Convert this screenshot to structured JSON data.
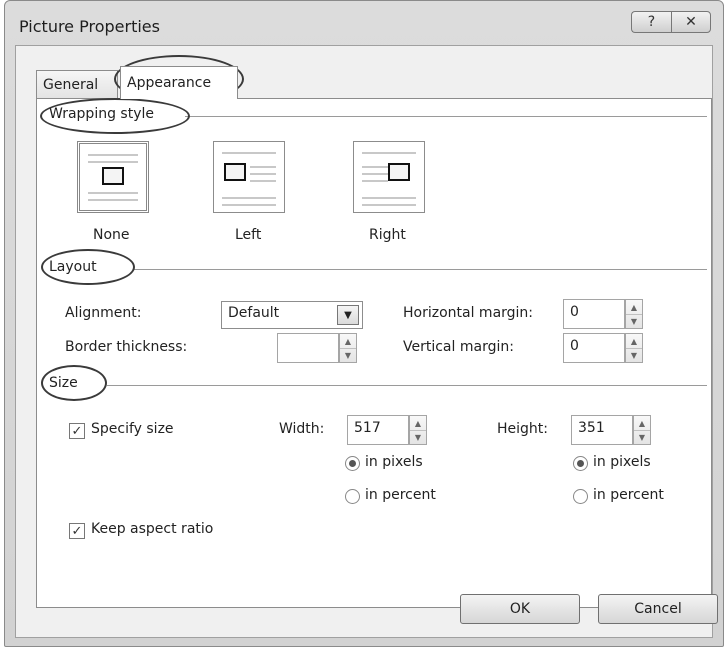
{
  "window": {
    "title": "Picture Properties",
    "help_glyph": "?",
    "close_glyph": "✕"
  },
  "tabs": [
    {
      "label": "General"
    },
    {
      "label": "Appearance"
    }
  ],
  "wrapping": {
    "section_label": "Wrapping style",
    "options": [
      {
        "label": "None"
      },
      {
        "label": "Left"
      },
      {
        "label": "Right"
      }
    ],
    "selected": "None"
  },
  "layout": {
    "section_label": "Layout",
    "alignment_label": "Alignment:",
    "alignment_value": "Default",
    "border_label": "Border thickness:",
    "border_value": "",
    "hmargin_label": "Horizontal margin:",
    "hmargin_value": "0",
    "vmargin_label": "Vertical margin:",
    "vmargin_value": "0"
  },
  "size": {
    "section_label": "Size",
    "specify_label": "Specify size",
    "specify_checked": true,
    "width_label": "Width:",
    "width_value": "517",
    "height_label": "Height:",
    "height_value": "351",
    "width_unit_pixels": "in pixels",
    "width_unit_percent": "in percent",
    "height_unit_pixels": "in pixels",
    "height_unit_percent": "in percent",
    "keep_aspect_label": "Keep aspect ratio",
    "keep_aspect_checked": true
  },
  "buttons": {
    "ok": "OK",
    "cancel": "Cancel"
  }
}
